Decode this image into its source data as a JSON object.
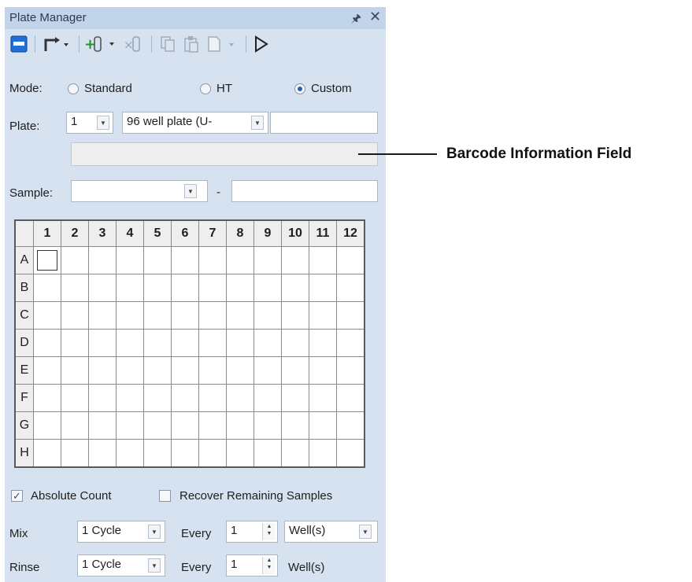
{
  "panel": {
    "title": "Plate Manager",
    "pin_icon": "pin-icon",
    "close_icon": "close-icon"
  },
  "toolbar": {
    "icons": [
      "single-plate-icon",
      "move-order-icon",
      "add-sample-icon",
      "delete-sample-icon",
      "copy-icon",
      "paste-icon",
      "save-icon",
      "run-icon"
    ],
    "colors": {
      "accent": "#1e6fd9",
      "add": "#1f9a2a"
    }
  },
  "mode": {
    "label": "Mode:",
    "options": [
      "Standard",
      "HT",
      "Custom"
    ],
    "selected": "Custom"
  },
  "plate": {
    "label": "Plate:",
    "number": "1",
    "type": "96 well plate (U-",
    "extra": "",
    "barcode": ""
  },
  "sample": {
    "label": "Sample:",
    "value": "",
    "dash": "-",
    "extra": ""
  },
  "grid": {
    "columns": [
      "1",
      "2",
      "3",
      "4",
      "5",
      "6",
      "7",
      "8",
      "9",
      "10",
      "11",
      "12"
    ],
    "rows": [
      "A",
      "B",
      "C",
      "D",
      "E",
      "F",
      "G",
      "H"
    ],
    "selected_well": "A1"
  },
  "options": {
    "absolute_count": {
      "label": "Absolute Count",
      "checked": true
    },
    "recover": {
      "label": "Recover Remaining Samples",
      "checked": false
    },
    "check_mark": "✓"
  },
  "mix": {
    "label": "Mix",
    "cycle": "1 Cycle",
    "every_label": "Every",
    "every_value": "1",
    "unit": "Well(s)"
  },
  "rinse": {
    "label": "Rinse",
    "cycle": "1 Cycle",
    "every_label": "Every",
    "every_value": "1",
    "unit": "Well(s)"
  },
  "callout": {
    "text": "Barcode Information Field"
  }
}
